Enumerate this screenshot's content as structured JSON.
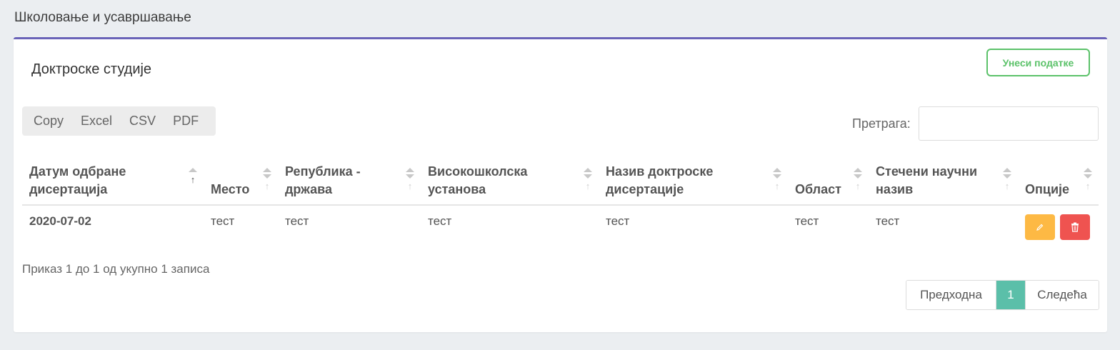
{
  "section_title": "Школовање и усавршавање",
  "card": {
    "title": "Доктроске студије",
    "add_button": "Унеси податке"
  },
  "export_buttons": [
    "Copy",
    "Excel",
    "CSV",
    "PDF"
  ],
  "search": {
    "label": "Претрага:",
    "value": ""
  },
  "table": {
    "headers": [
      [
        "Датум одбране",
        "дисертација"
      ],
      [
        "",
        "Место"
      ],
      [
        "Република -",
        "држава"
      ],
      [
        "Високошколска",
        "установа"
      ],
      [
        "Назив доктроске",
        "дисертације"
      ],
      [
        "",
        "Област"
      ],
      [
        "Стечени научни",
        "назив"
      ],
      [
        "",
        "Опције"
      ]
    ],
    "sort_arrow": "↑",
    "rows": [
      [
        "2020-07-02",
        "тест",
        "тест",
        "тест",
        "тест",
        "тест",
        "тест"
      ]
    ]
  },
  "info": "Приказ 1 до 1 од укупно 1 записа",
  "pagination": {
    "prev": "Предходна",
    "current": "1",
    "next": "Следећа"
  },
  "colors": {
    "accent_border": "#6a63b8",
    "add_button": "#5cc26a",
    "edit_button": "#fdb944",
    "delete_button": "#ef5350",
    "active_page": "#5bbfa9"
  },
  "icons": {
    "edit": "pencil-icon",
    "delete": "trash-icon"
  }
}
